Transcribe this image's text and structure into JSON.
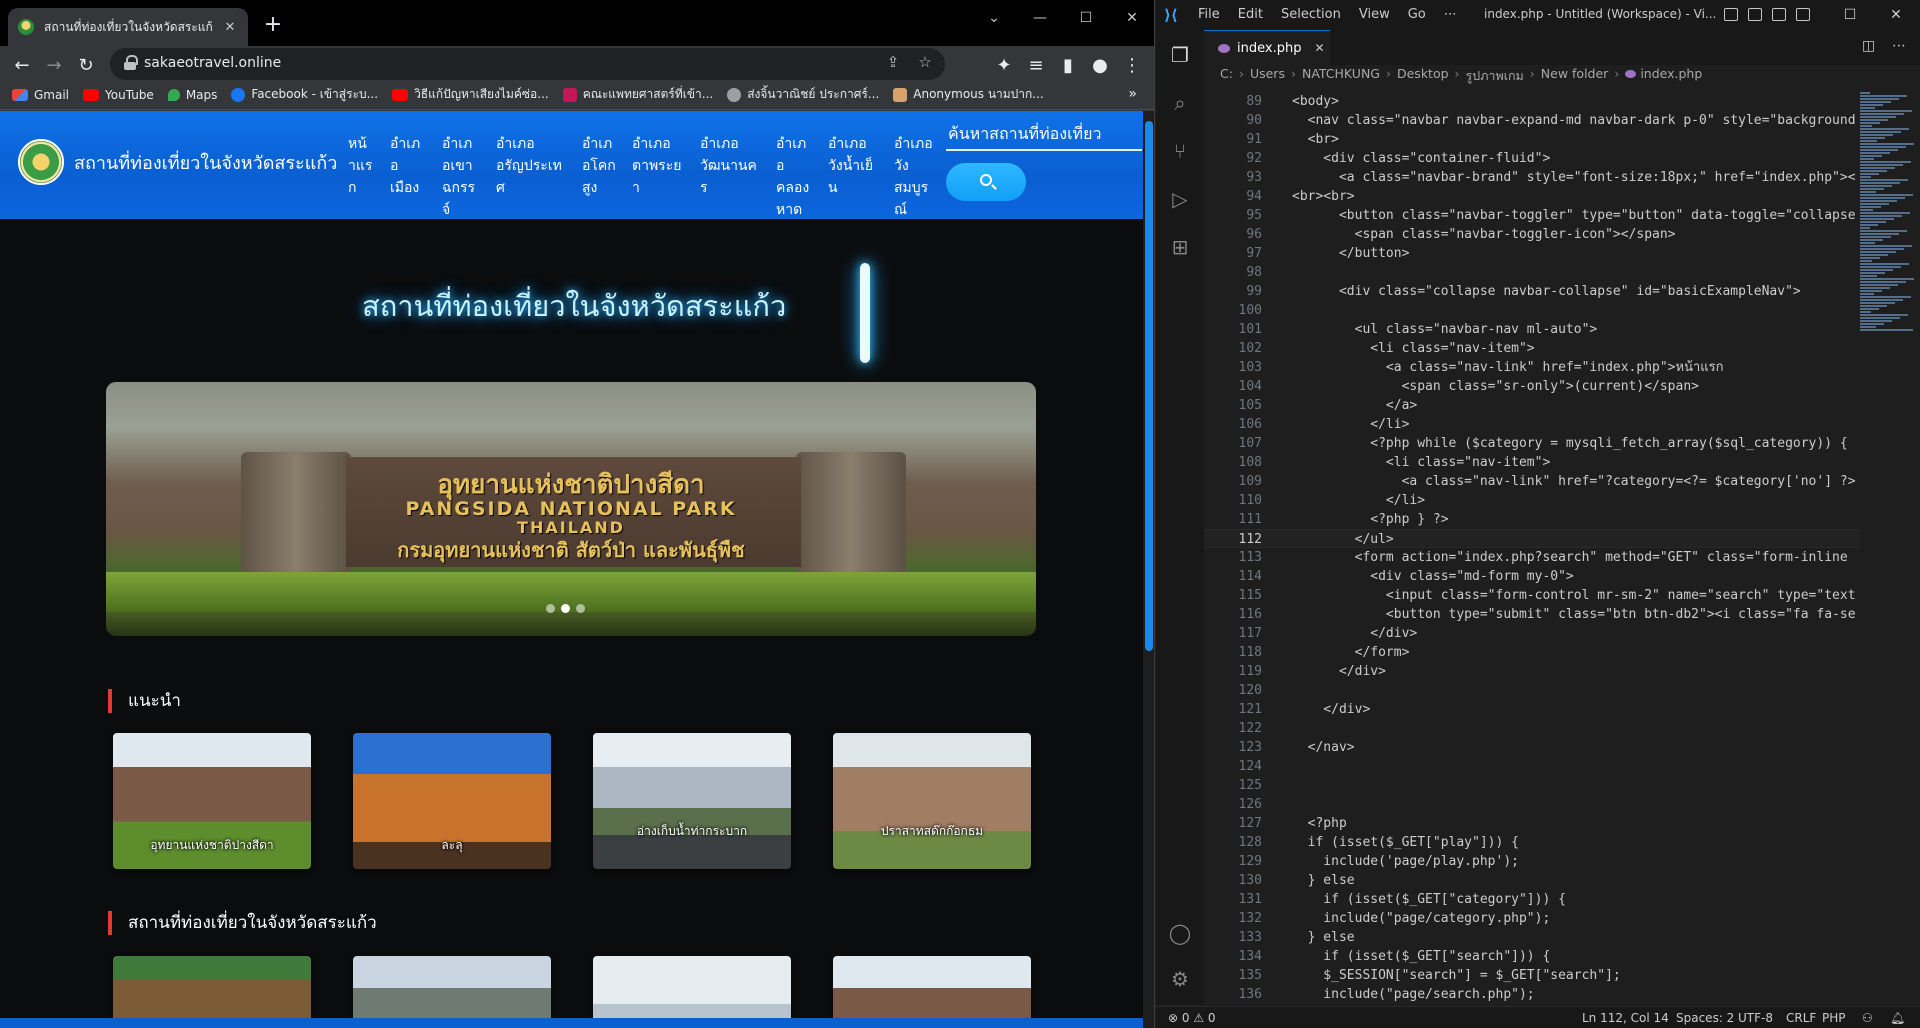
{
  "browser": {
    "tab_title": "สถานที่ท่องเที่ยวในจังหวัดสระแก้ว",
    "url": "sakaeotravel.online",
    "bookmarks": [
      {
        "label": "Gmail",
        "icon": "gmail-icon"
      },
      {
        "label": "YouTube",
        "icon": "youtube-icon"
      },
      {
        "label": "Maps",
        "icon": "maps-icon"
      },
      {
        "label": "Facebook - เข้าสู่ระบ...",
        "icon": "facebook-icon"
      },
      {
        "label": "วิธีแก้ปัญหาเสียงไมค์ซ่อ...",
        "icon": "youtube-icon"
      },
      {
        "label": "คณะแพทยศาสตร์ที่เข้า...",
        "icon": "medical-icon"
      },
      {
        "label": "ส่งจิ้นวาณิชย์ ประกาศร์...",
        "icon": "globe-icon"
      },
      {
        "label": "Anonymous นามปาก...",
        "icon": "image-icon"
      }
    ]
  },
  "site": {
    "brand": "สถานที่ท่องเที่ยวในจังหวัดสระแก้ว",
    "menu": [
      "หน้าแรก",
      "อำเภอเมือง",
      "อำเภอเขาฉกรรจ์",
      "อำเภออรัญประเทศ",
      "อำเภอโคกสูง",
      "อำเภอตาพระยา",
      "อำเภอวัฒนานคร",
      "อำเภอคลองหาด",
      "อำเภอวังน้ำเย็น",
      "อำเภอวังสมบูรณ์"
    ],
    "search_placeholder": "ค้นหาสถานที่ท่องเที่ยว",
    "hero_title": "สถานที่ท่องเที่ยวในจังหวัดสระแก้ว",
    "carousel": {
      "sign_th": "อุทยานแห่งชาติปางสีดา",
      "sign_en": "PANGSIDA   NATIONAL PARK",
      "sign_country": "THAILAND",
      "sign_dept": "กรมอุทยานแห่งชาติ สัตว์ป่า และพันธุ์พืช",
      "slides": 3,
      "active_slide": 2
    },
    "section_recommend": "แนะนำ",
    "recommend": [
      {
        "caption": "อุทยานแห่งชาติปางสีดา"
      },
      {
        "caption": "ละลุ"
      },
      {
        "caption": "อ่างเก็บน้ำท่ากระบาก"
      },
      {
        "caption": "ปราสาทสด๊กก๊อกธม"
      }
    ],
    "section_all": "สถานที่ท่องเที่ยวในจังหวัดสระแก้ว"
  },
  "vscode": {
    "menu": [
      "File",
      "Edit",
      "Selection",
      "View",
      "Go",
      "⋯"
    ],
    "window_title": "index.php - Untitled (Workspace) - Vi...",
    "tab_name": "index.php",
    "breadcrumb": [
      "C:",
      "Users",
      "NATCHKUNG",
      "Desktop",
      "รูปภาพเกม",
      "New folder",
      "index.php"
    ],
    "current_line": 112,
    "code": [
      {
        "n": "89",
        "t": "<body>"
      },
      {
        "n": "90",
        "t": "  <nav class=\"navbar navbar-expand-md navbar-dark p-0\" style=\"background"
      },
      {
        "n": "91",
        "t": "  <br>"
      },
      {
        "n": "92",
        "t": "    <div class=\"container-fluid\">"
      },
      {
        "n": "93",
        "t": "      <a class=\"navbar-brand\" style=\"font-size:18px;\" href=\"index.php\"><"
      },
      {
        "n": "94",
        "t": "<br><br>"
      },
      {
        "n": "95",
        "t": "      <button class=\"navbar-toggler\" type=\"button\" data-toggle=\"collapse"
      },
      {
        "n": "96",
        "t": "        <span class=\"navbar-toggler-icon\"></span>"
      },
      {
        "n": "97",
        "t": "      </button>"
      },
      {
        "n": "98",
        "t": ""
      },
      {
        "n": "99",
        "t": "      <div class=\"collapse navbar-collapse\" id=\"basicExampleNav\">"
      },
      {
        "n": "100",
        "t": ""
      },
      {
        "n": "101",
        "t": "        <ul class=\"navbar-nav ml-auto\">"
      },
      {
        "n": "102",
        "t": "          <li class=\"nav-item\">"
      },
      {
        "n": "103",
        "t": "            <a class=\"nav-link\" href=\"index.php\">หน้าแรก"
      },
      {
        "n": "104",
        "t": "              <span class=\"sr-only\">(current)</span>"
      },
      {
        "n": "105",
        "t": "            </a>"
      },
      {
        "n": "106",
        "t": "          </li>"
      },
      {
        "n": "107",
        "t": "          <?php while ($category = mysqli_fetch_array($sql_category)) {"
      },
      {
        "n": "108",
        "t": "            <li class=\"nav-item\">"
      },
      {
        "n": "109",
        "t": "              <a class=\"nav-link\" href=\"?category=<?= $category['no'] ?>"
      },
      {
        "n": "110",
        "t": "            </li>"
      },
      {
        "n": "111",
        "t": "          <?php } ?>"
      },
      {
        "n": "112",
        "t": "        </ul>"
      },
      {
        "n": "113",
        "t": "        <form action=\"index.php?search\" method=\"GET\" class=\"form-inline"
      },
      {
        "n": "114",
        "t": "          <div class=\"md-form my-0\">"
      },
      {
        "n": "115",
        "t": "            <input class=\"form-control mr-sm-2\" name=\"search\" type=\"text"
      },
      {
        "n": "116",
        "t": "            <button type=\"submit\" class=\"btn btn-db2\"><i class=\"fa fa-se"
      },
      {
        "n": "117",
        "t": "          </div>"
      },
      {
        "n": "118",
        "t": "        </form>"
      },
      {
        "n": "119",
        "t": "      </div>"
      },
      {
        "n": "120",
        "t": ""
      },
      {
        "n": "121",
        "t": "    </div>"
      },
      {
        "n": "122",
        "t": ""
      },
      {
        "n": "123",
        "t": "  </nav>"
      },
      {
        "n": "124",
        "t": ""
      },
      {
        "n": "125",
        "t": ""
      },
      {
        "n": "126",
        "t": ""
      },
      {
        "n": "127",
        "t": "  <?php"
      },
      {
        "n": "128",
        "t": "  if (isset($_GET[\"play\"])) {"
      },
      {
        "n": "129",
        "t": "    include('page/play.php');"
      },
      {
        "n": "130",
        "t": "  } else"
      },
      {
        "n": "131",
        "t": "    if (isset($_GET[\"category\"])) {"
      },
      {
        "n": "132",
        "t": "    include(\"page/category.php\");"
      },
      {
        "n": "133",
        "t": "  } else"
      },
      {
        "n": "134",
        "t": "    if (isset($_GET[\"search\"])) {"
      },
      {
        "n": "135",
        "t": "    $_SESSION[\"search\"] = $_GET[\"search\"];"
      },
      {
        "n": "136",
        "t": "    include(\"page/search.php\");"
      }
    ],
    "status": {
      "problems": "⊗ 0 ⚠ 0",
      "position": "Ln 112, Col 14",
      "spaces": "Spaces: 2",
      "encoding": "UTF-8",
      "eol": "CRLF",
      "language": "PHP"
    }
  }
}
